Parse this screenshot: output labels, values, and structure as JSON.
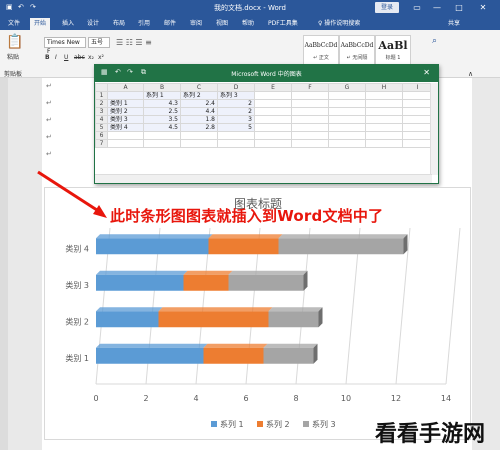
{
  "window": {
    "title": "我的文档.docx - Word",
    "login": "登录",
    "controls": [
      "▭",
      "—",
      "□",
      "✕"
    ]
  },
  "tabs": {
    "items": [
      "文件",
      "开始",
      "插入",
      "设计",
      "布局",
      "引用",
      "邮件",
      "审阅",
      "视图",
      "帮助",
      "PDF工具集"
    ],
    "active_index": 1,
    "tell_me": "♀ 操作说明搜索",
    "share": "共享"
  },
  "ribbon": {
    "paste_label": "粘贴",
    "clipboard_label": "剪贴板",
    "font_name": "Times New F",
    "font_size": "五号",
    "format_buttons": [
      "B",
      "I",
      "U",
      "abc",
      "x₂",
      "x²"
    ],
    "styles": [
      {
        "sample": "AaBbCcDd",
        "name": "↵ 正文"
      },
      {
        "sample": "AaBbCcDd",
        "name": "↵ 无间隔"
      },
      {
        "sample": "AaBl",
        "name": "标题 1"
      }
    ]
  },
  "document": {
    "para_mark": "↵"
  },
  "excel": {
    "title": "Microsoft Word 中的图表",
    "close": "✕",
    "col_headers": [
      "",
      "A",
      "B",
      "C",
      "D",
      "E",
      "F",
      "G",
      "H",
      "I"
    ],
    "rows": [
      [
        "1",
        "",
        "系列 1",
        "系列 2",
        "系列 3",
        "",
        "",
        "",
        "",
        ""
      ],
      [
        "2",
        "类别 1",
        "4.3",
        "2.4",
        "2",
        "",
        "",
        "",
        "",
        ""
      ],
      [
        "3",
        "类别 2",
        "2.5",
        "4.4",
        "2",
        "",
        "",
        "",
        "",
        ""
      ],
      [
        "4",
        "类别 3",
        "3.5",
        "1.8",
        "3",
        "",
        "",
        "",
        "",
        ""
      ],
      [
        "5",
        "类别 4",
        "4.5",
        "2.8",
        "5",
        "",
        "",
        "",
        "",
        ""
      ],
      [
        "6",
        "",
        "",
        "",
        "",
        "",
        "",
        "",
        "",
        ""
      ],
      [
        "7",
        "",
        "",
        "",
        "",
        "",
        "",
        "",
        "",
        ""
      ]
    ]
  },
  "annotation": "此时条形图图表就插入到Word文档中了",
  "watermark": "看看手游网",
  "chart_data": {
    "type": "bar",
    "orientation": "horizontal",
    "stacked": true,
    "title": "图表标题",
    "categories": [
      "类别 1",
      "类别 2",
      "类别 3",
      "类别 4"
    ],
    "series": [
      {
        "name": "系列 1",
        "values": [
          4.3,
          2.5,
          3.5,
          4.5
        ],
        "color": "#5b9bd5"
      },
      {
        "name": "系列 2",
        "values": [
          2.4,
          4.4,
          1.8,
          2.8
        ],
        "color": "#ed7d31"
      },
      {
        "name": "系列 3",
        "values": [
          2,
          2,
          3,
          5
        ],
        "color": "#a5a5a5"
      }
    ],
    "xlim": [
      0,
      14
    ],
    "xticks": [
      0,
      2,
      4,
      6,
      8,
      10,
      12,
      14
    ],
    "grid": true,
    "legend": "bottom"
  }
}
